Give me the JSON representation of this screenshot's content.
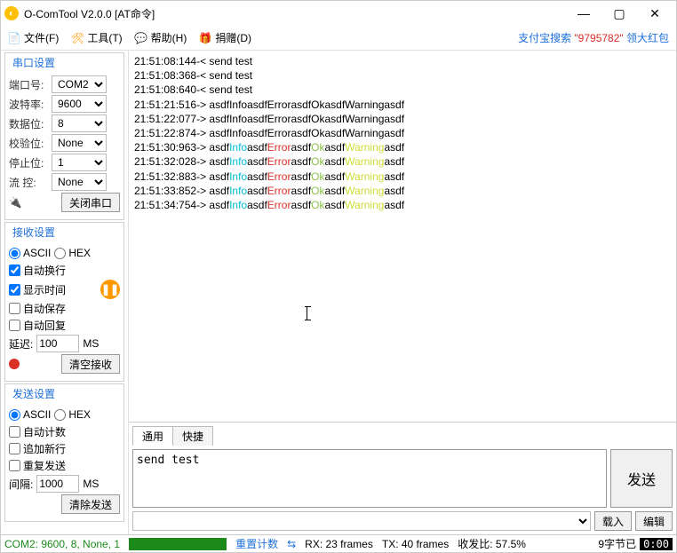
{
  "window": {
    "title": "O-ComTool V2.0.0 [AT命令]"
  },
  "menu": {
    "file": "文件(F)",
    "tools": "工具(T)",
    "help": "帮助(H)",
    "donate": "捐赠(D)",
    "ad_prefix": "支付宝搜索 ",
    "ad_num": "\"9795782\"",
    "ad_suffix": " 领大红包"
  },
  "port": {
    "title": "串口设置",
    "port_lbl": "端口号:",
    "port": "COM2",
    "baud_lbl": "波特率:",
    "baud": "9600",
    "data_lbl": "数据位:",
    "data": "8",
    "parity_lbl": "校验位:",
    "parity": "None",
    "stop_lbl": "停止位:",
    "stop": "1",
    "flow_lbl": "流  控:",
    "flow": "None",
    "close": "关闭串口"
  },
  "recv": {
    "title": "接收设置",
    "ascii": "ASCII",
    "hex": "HEX",
    "wrap": "自动换行",
    "time": "显示时间",
    "save": "自动保存",
    "reply": "自动回复",
    "delay_lbl": "延迟:",
    "delay": "100",
    "ms": "MS",
    "clear": "清空接收"
  },
  "send": {
    "title": "发送设置",
    "ascii": "ASCII",
    "hex": "HEX",
    "count": "自动计数",
    "newline": "追加新行",
    "repeat": "重复发送",
    "interval_lbl": "间隔:",
    "interval": "1000",
    "ms": "MS",
    "clear": "清除发送"
  },
  "tabs": {
    "general": "通用",
    "quick": "快捷"
  },
  "sendbox": {
    "text": "send test",
    "sendbtn": "发送",
    "load": "载入",
    "edit": "编辑"
  },
  "log": [
    {
      "t": "21:51:08:144-< ",
      "plain": "send test"
    },
    {
      "t": "21:51:08:368-< ",
      "plain": "send test"
    },
    {
      "t": "21:51:08:640-< ",
      "plain": "send test"
    },
    {
      "t": "21:51:21:516-> ",
      "plain": "asdfInfoasdfErrorasdfOkasdfWarningasdf"
    },
    {
      "t": "21:51:22:077-> ",
      "plain": "asdfInfoasdfErrorasdfOkasdfWarningasdf"
    },
    {
      "t": "21:51:22:874-> ",
      "plain": "asdfInfoasdfErrorasdfOkasdfWarningasdf"
    },
    {
      "t": "21:51:30:963-> ",
      "color": true
    },
    {
      "t": "21:51:32:028-> ",
      "color": true
    },
    {
      "t": "21:51:32:883-> ",
      "color": true
    },
    {
      "t": "21:51:33:852-> ",
      "color": true
    },
    {
      "t": "21:51:34:754-> ",
      "color": true
    }
  ],
  "status": {
    "conn": "COM2: 9600, 8, None, 1",
    "reset": "重置计数",
    "rx": "RX: 23 frames",
    "tx": "TX: 40 frames",
    "ratio": "收发比:  57.5%",
    "bytes": "9字节已",
    "clock": "0:00"
  }
}
